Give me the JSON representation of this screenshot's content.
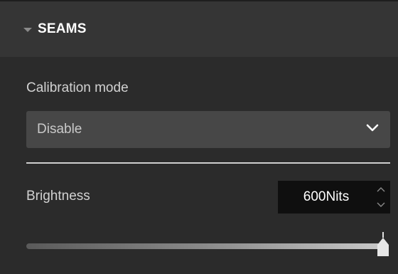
{
  "section": {
    "title": "SEAMS",
    "expanded": true
  },
  "calibration": {
    "label": "Calibration mode",
    "selected": "Disable"
  },
  "brightness": {
    "label": "Brightness",
    "value_text": "600Nits",
    "slider_fraction": 1.0
  },
  "colors": {
    "background": "#2b2b2b",
    "header_background": "#353535",
    "dropdown_background": "#474747",
    "spinbox_background": "#0f0f0f",
    "text": "#d2d2d2"
  },
  "icons": {
    "header_caret": "caret-down-icon",
    "dropdown": "chevron-down-icon",
    "spin_up": "chevron-up-icon",
    "spin_down": "chevron-down-icon",
    "slider_thumb": "slider-thumb-icon"
  }
}
